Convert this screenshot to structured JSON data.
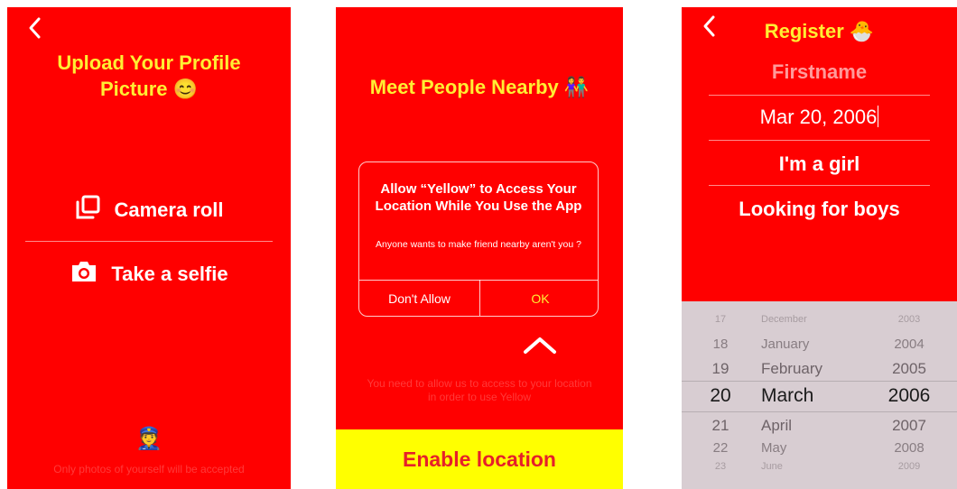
{
  "colors": {
    "screen_bg": "#ff0000",
    "accent_yellow": "#ffee33",
    "button_yellow": "#ffff00",
    "text_white": "#ffffff"
  },
  "profile_screen": {
    "title_line1": "Upload Your Profile",
    "title_line2": "Picture 😊",
    "options": [
      {
        "icon": "photo-stack-icon",
        "label": "Camera roll"
      },
      {
        "icon": "camera-icon",
        "label": "Take a selfie"
      }
    ],
    "footer_icon": "👮",
    "footer_text": "Only photos of yourself will be accepted"
  },
  "location_screen": {
    "title": "Meet People Nearby 👫",
    "dialog": {
      "title": "Allow “Yellow” to Access Your Location While You Use the App",
      "message": "Anyone wants to make friend nearby aren't you ?",
      "deny_label": "Don't Allow",
      "allow_label": "OK"
    },
    "chevron_icon": "chevron-up-icon",
    "hint_text": "You need to allow us to access to your location in order to use Yellow",
    "enable_label": "Enable location"
  },
  "register_screen": {
    "title": "Register 🐣",
    "firstname_placeholder": "Firstname",
    "birthdate": "Mar 20, 2006",
    "gender": "I'm a girl",
    "looking_for": "Looking for boys",
    "picker": {
      "rows": [
        {
          "day": "17",
          "month": "December",
          "year": "2003"
        },
        {
          "day": "18",
          "month": "January",
          "year": "2004"
        },
        {
          "day": "19",
          "month": "February",
          "year": "2005"
        },
        {
          "day": "20",
          "month": "March",
          "year": "2006"
        },
        {
          "day": "21",
          "month": "April",
          "year": "2007"
        },
        {
          "day": "22",
          "month": "May",
          "year": "2008"
        },
        {
          "day": "23",
          "month": "June",
          "year": "2009"
        }
      ]
    }
  }
}
